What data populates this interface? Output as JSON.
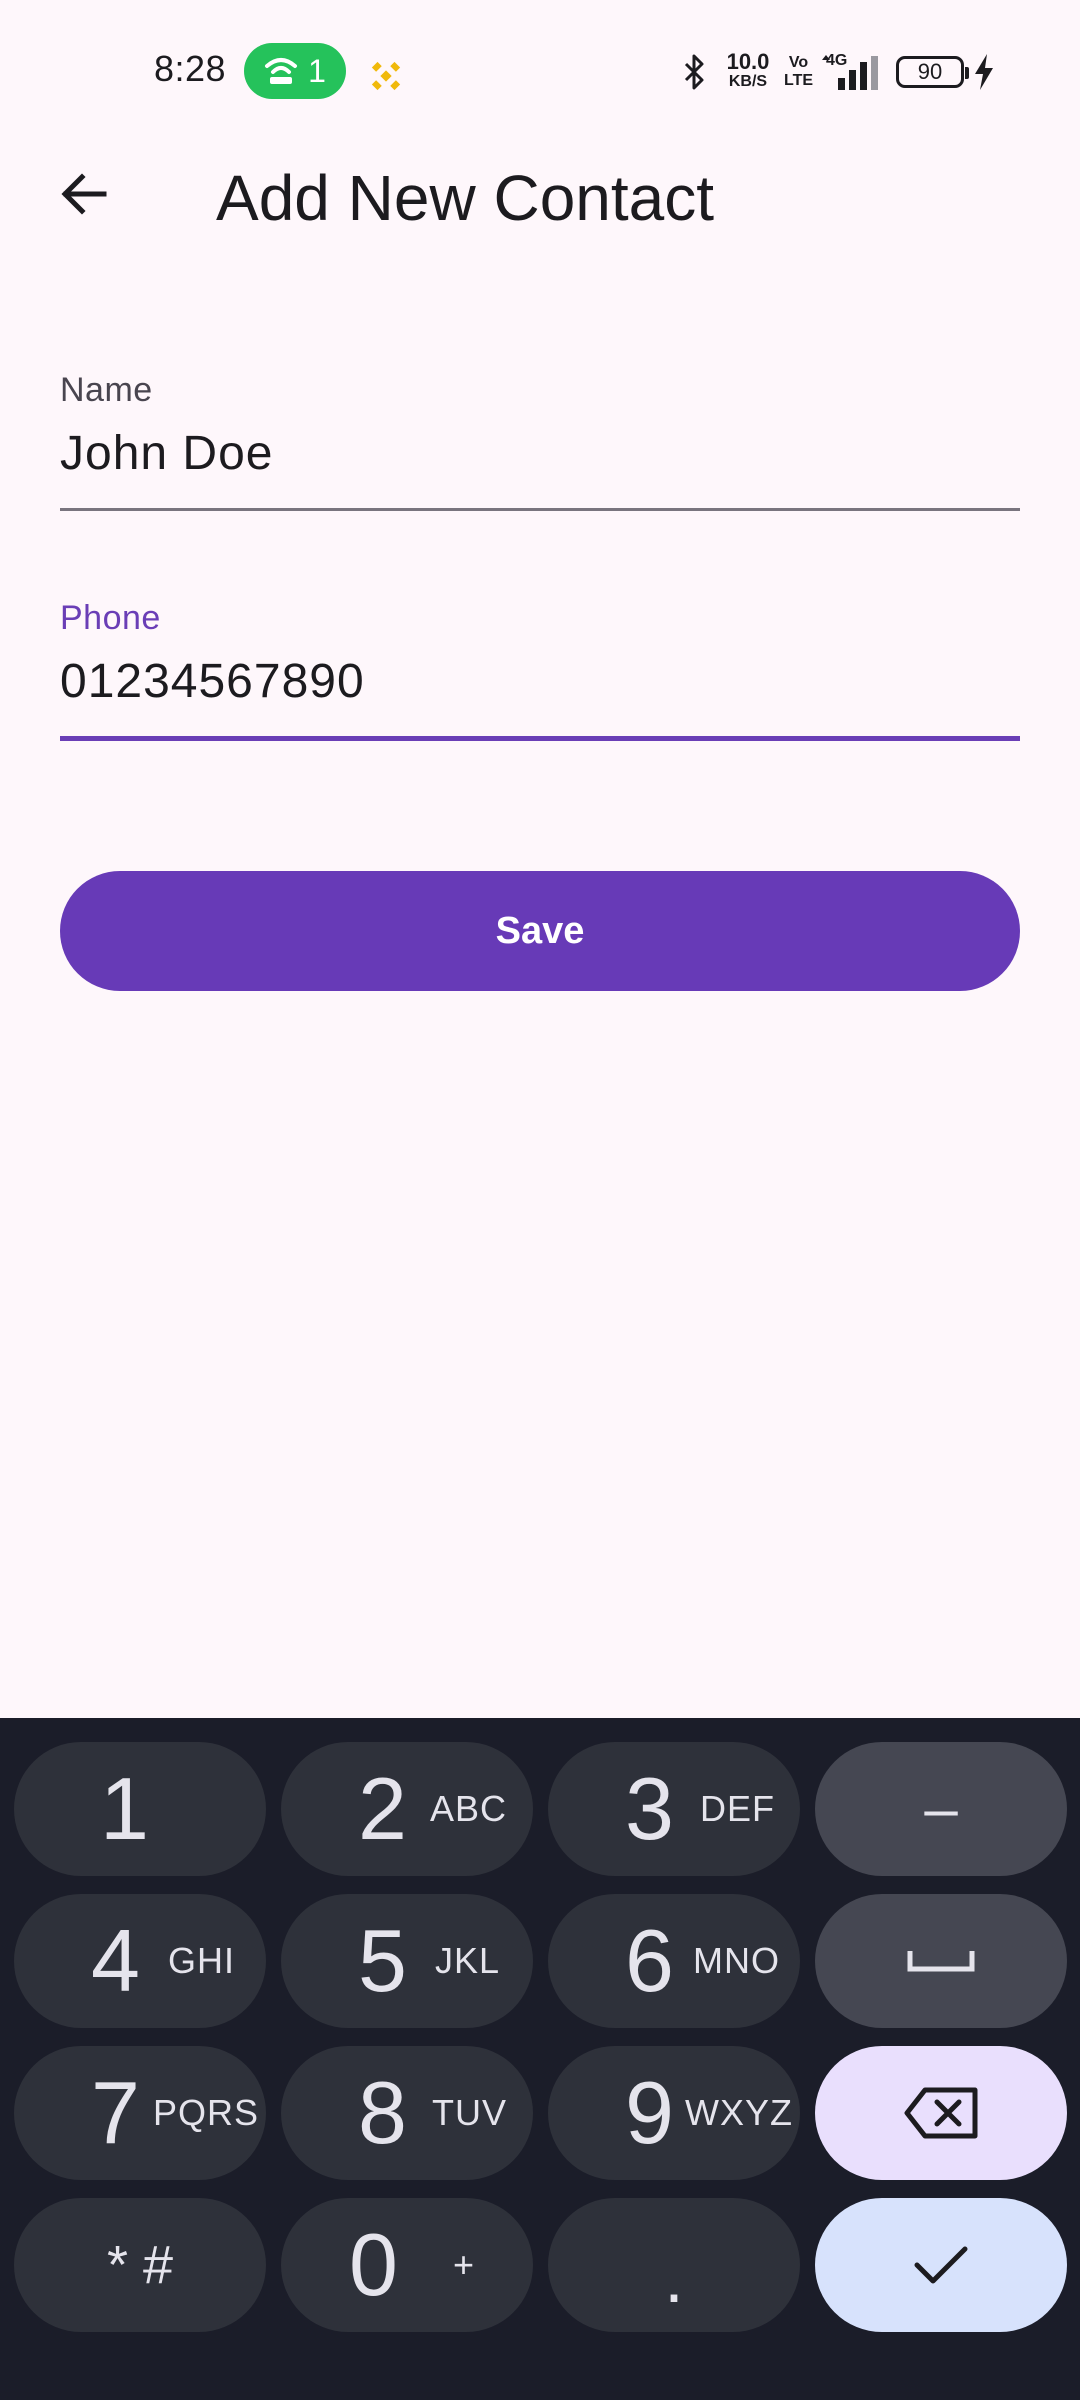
{
  "status_bar": {
    "time": "8:28",
    "hotspot_count": "1",
    "net_speed": "10.0",
    "net_speed_unit": "KB/S",
    "volte_top": "Vo",
    "volte_bottom": "LTE",
    "network_type": "4G",
    "battery_level": "90"
  },
  "header": {
    "title": "Add New Contact",
    "back_icon": "arrow-back-icon"
  },
  "form": {
    "name": {
      "label": "Name",
      "value": "John Doe"
    },
    "phone": {
      "label": "Phone",
      "value": "01234567890"
    },
    "save_label": "Save"
  },
  "keyboard": {
    "rows": [
      [
        {
          "main": "1",
          "sub": ""
        },
        {
          "main": "2",
          "sub": "ABC"
        },
        {
          "main": "3",
          "sub": "DEF"
        },
        {
          "main": "–",
          "sub": ""
        }
      ],
      [
        {
          "main": "4",
          "sub": "GHI"
        },
        {
          "main": "5",
          "sub": "JKL"
        },
        {
          "main": "6",
          "sub": "MNO"
        },
        {
          "main": "space-icon",
          "sub": ""
        }
      ],
      [
        {
          "main": "7",
          "sub": "PQRS"
        },
        {
          "main": "8",
          "sub": "TUV"
        },
        {
          "main": "9",
          "sub": "WXYZ"
        },
        {
          "main": "backspace-icon",
          "sub": ""
        }
      ],
      [
        {
          "main": "* #",
          "sub": ""
        },
        {
          "main": "0",
          "sub": "+"
        },
        {
          "main": ".",
          "sub": ""
        },
        {
          "main": "check-icon",
          "sub": ""
        }
      ]
    ]
  },
  "colors": {
    "background": "#fef7fb",
    "accent": "#673ab7",
    "keyboard_bg": "#1b1d29",
    "key_bg": "#2e313a",
    "hotspot": "#25c25b"
  }
}
